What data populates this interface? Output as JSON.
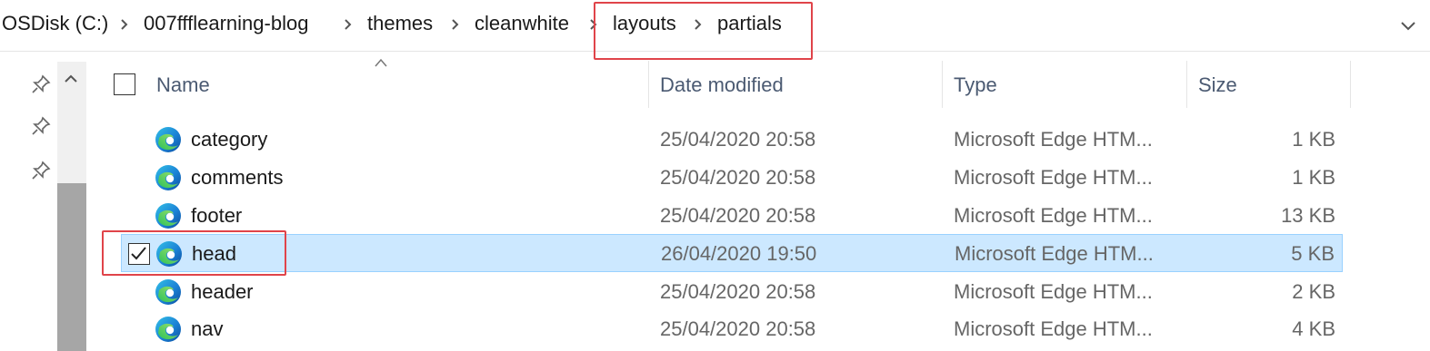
{
  "breadcrumb": {
    "items": [
      "OSDisk (C:)",
      "007ffflearning-blog",
      "themes",
      "cleanwhite",
      "layouts",
      "partials"
    ]
  },
  "columns": {
    "name": "Name",
    "date": "Date modified",
    "type": "Type",
    "size": "Size"
  },
  "files": [
    {
      "name": "category",
      "date": "25/04/2020 20:58",
      "type": "Microsoft Edge HTM...",
      "size": "1 KB",
      "selected": false
    },
    {
      "name": "comments",
      "date": "25/04/2020 20:58",
      "type": "Microsoft Edge HTM...",
      "size": "1 KB",
      "selected": false
    },
    {
      "name": "footer",
      "date": "25/04/2020 20:58",
      "type": "Microsoft Edge HTM...",
      "size": "13 KB",
      "selected": false
    },
    {
      "name": "head",
      "date": "26/04/2020 19:50",
      "type": "Microsoft Edge HTM...",
      "size": "5 KB",
      "selected": true
    },
    {
      "name": "header",
      "date": "25/04/2020 20:58",
      "type": "Microsoft Edge HTM...",
      "size": "2 KB",
      "selected": false
    },
    {
      "name": "nav",
      "date": "25/04/2020 20:58",
      "type": "Microsoft Edge HTM...",
      "size": "4 KB",
      "selected": false
    }
  ],
  "icons": {
    "file": "edge-html-file-icon",
    "pin": "pin-icon",
    "separator": "chevron-right-icon",
    "expand": "chevron-down-icon",
    "sort": "sort-ascending-icon",
    "scroll_up": "scroll-up-icon"
  },
  "colors": {
    "selection_bg": "#cce8ff",
    "selection_border": "#99d1ff",
    "highlight_box": "#e0444a",
    "header_text": "#4b5a72",
    "detail_text": "#666666"
  }
}
